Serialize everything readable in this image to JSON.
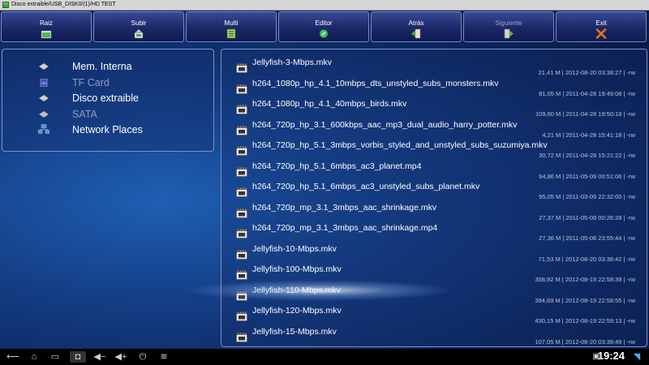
{
  "window": {
    "title": "Disco extraible/USB_DISK0/(1)/HD TEST"
  },
  "toolbar": {
    "buttons": [
      {
        "label": "Raiz",
        "icon": "home-icon",
        "enabled": true
      },
      {
        "label": "Subir",
        "icon": "up-folder-icon",
        "enabled": true
      },
      {
        "label": "Multi",
        "icon": "multi-select-icon",
        "enabled": true
      },
      {
        "label": "Editor",
        "icon": "editor-icon",
        "enabled": true
      },
      {
        "label": "Atrás",
        "icon": "back-icon",
        "enabled": true
      },
      {
        "label": "Siguiente",
        "icon": "forward-icon",
        "enabled": false
      },
      {
        "label": "Exit",
        "icon": "exit-icon",
        "enabled": true
      }
    ]
  },
  "storage": [
    {
      "label": "Mem. Interna",
      "icon": "internal-memory-icon",
      "enabled": true
    },
    {
      "label": "TF Card",
      "icon": "sd-card-icon",
      "enabled": false
    },
    {
      "label": "Disco extraible",
      "icon": "usb-drive-icon",
      "enabled": true
    },
    {
      "label": "SATA",
      "icon": "sata-drive-icon",
      "enabled": false
    },
    {
      "label": "Network Places",
      "icon": "network-icon",
      "enabled": true
    }
  ],
  "files": [
    {
      "name": "Jellyfish-3-Mbps.mkv",
      "meta": "21,41 M | 2012-08-20 03:38:27 | -rw"
    },
    {
      "name": "h264_1080p_hp_4.1_10mbps_dts_unstyled_subs_monsters.mkv",
      "meta": "81,05 M | 2011-04-28 19:49:08 | -rw"
    },
    {
      "name": "h264_1080p_hp_4.1_40mbps_birds.mkv",
      "meta": "109,60 M | 2011-04-28 19:50:18 | -rw"
    },
    {
      "name": "h264_720p_hp_3.1_600kbps_aac_mp3_dual_audio_harry_potter.mkv",
      "meta": "4,21 M | 2011-04-28 15:41:18 | -rw"
    },
    {
      "name": "h264_720p_hp_5.1_3mbps_vorbis_styled_and_unstyled_subs_suzumiya.mkv",
      "meta": "30,72 M | 2011-04-28 15:21:22 | -rw"
    },
    {
      "name": "h264_720p_hp_5.1_6mbps_ac3_planet.mp4",
      "meta": "94,86 M | 2011-05-09 00:51:06 | -rw"
    },
    {
      "name": "h264_720p_hp_5.1_6mbps_ac3_unstyled_subs_planet.mkv",
      "meta": "95,05 M | 2011-03-09 22:32:00 | -rw"
    },
    {
      "name": "h264_720p_mp_3.1_3mbps_aac_shrinkage.mkv",
      "meta": "27,37 M | 2011-05-09 00:26:28 | -rw"
    },
    {
      "name": "h264_720p_mp_3.1_3mbps_aac_shrinkage.mp4",
      "meta": "27,36 M | 2011-05-08 23:55:44 | -rw"
    },
    {
      "name": "Jellyfish-10-Mbps.mkv",
      "meta": "71,53 M | 2012-08-20 03:38:42 | -rw"
    },
    {
      "name": "Jellyfish-100-Mbps.mkv",
      "meta": "358,92 M | 2012-08-19 22:58:39 | -rw"
    },
    {
      "name": "Jellyfish-110-Mbps.mkv",
      "meta": "394,69 M | 2012-08-19 22:58:55 | -rw"
    },
    {
      "name": "Jellyfish-120-Mbps.mkv",
      "meta": "430,15 M | 2012-08-19 22:59:13 | -rw"
    },
    {
      "name": "Jellyfish-15-Mbps.mkv",
      "meta": "107,05 M | 2012-08-20 03:38:49 | -rw"
    }
  ],
  "navbar": {
    "icons": [
      "back-nav-icon",
      "home-nav-icon",
      "recent-apps-icon",
      "screenshot-icon",
      "volume-down-icon",
      "volume-up-icon",
      "power-icon",
      "menu-collapse-icon"
    ],
    "time": "19:24",
    "status_icons": [
      "image-notification-icon",
      "wifi-icon"
    ]
  },
  "colors": {
    "accent": "#1a2869",
    "panel_border": "#7d8fc4",
    "exit_icon": "#e07a1a"
  }
}
